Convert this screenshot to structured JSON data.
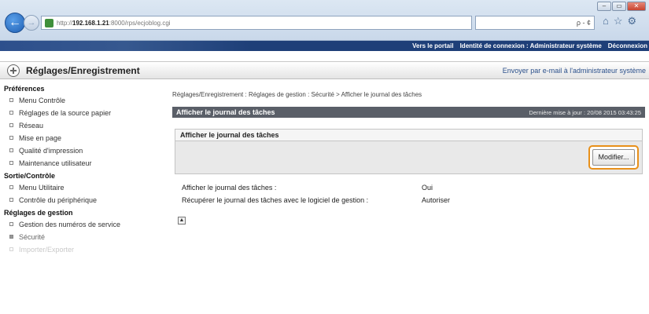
{
  "browser": {
    "url_prefix": "http://",
    "url_host": "192.168.1.21",
    "url_rest": ":8000/rps/ecjoblog.cgi",
    "search_glyph": "ρ - ¢",
    "window_buttons": [
      "–",
      "▭",
      "✕"
    ],
    "toolbar_icons": [
      "⌂",
      "☆",
      "⚙"
    ]
  },
  "portal": {
    "portal_link": "Vers le portail",
    "login_identity": "Identité de connexion : Administrateur système",
    "logout": "Déconnexion"
  },
  "header": {
    "title": "Réglages/Enregistrement",
    "mail_link": "Envoyer par e-mail à l'administrateur système"
  },
  "sidebar": {
    "sections": [
      {
        "heading": "Préférences",
        "items": [
          {
            "label": "Menu Contrôle"
          },
          {
            "label": "Réglages de la source papier"
          },
          {
            "label": "Réseau"
          },
          {
            "label": "Mise en page"
          },
          {
            "label": "Qualité d'impression"
          },
          {
            "label": "Maintenance utilisateur"
          }
        ]
      },
      {
        "heading": "Sortie/Contrôle",
        "items": [
          {
            "label": "Menu Utilitaire"
          },
          {
            "label": "Contrôle du périphérique"
          }
        ]
      },
      {
        "heading": "Réglages de gestion",
        "items": [
          {
            "label": "Gestion des numéros de service"
          },
          {
            "label": "Sécurité"
          },
          {
            "label": "Importer/Exporter"
          }
        ]
      }
    ]
  },
  "main": {
    "breadcrumb": "Réglages/Enregistrement : Réglages de gestion : Sécurité > Afficher le journal des tâches",
    "panel_title": "Afficher le journal des tâches",
    "last_updated": "Dernière mise à jour : 20/08 2015 03:43:25",
    "section_title": "Afficher le journal des tâches",
    "modify_button": "Modifier...",
    "settings": [
      {
        "label": "Afficher le journal des tâches :",
        "value": "Oui"
      },
      {
        "label": "Récupérer le journal des tâches avec le logiciel de gestion :",
        "value": "Autoriser"
      }
    ],
    "top_icon": "▲"
  }
}
